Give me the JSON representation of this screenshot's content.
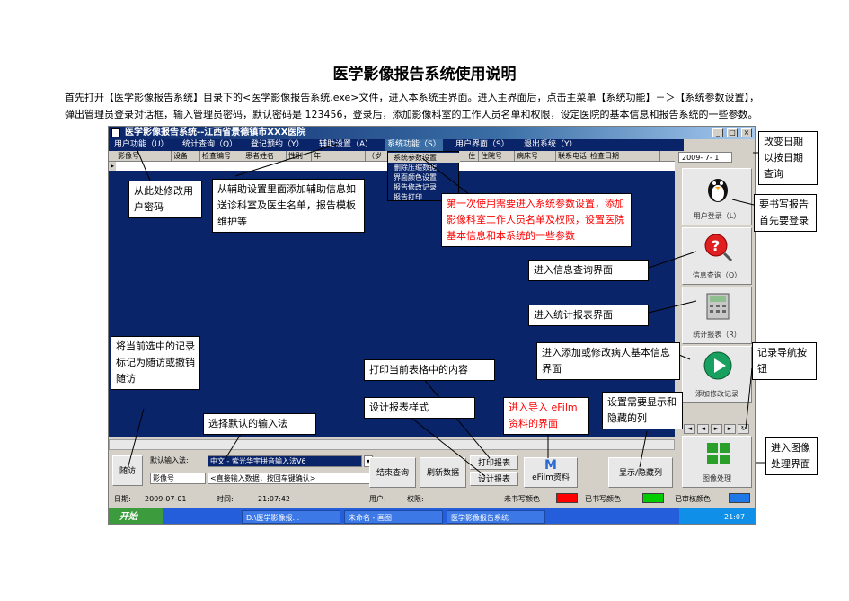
{
  "doc": {
    "title": "医学影像报告系统使用说明",
    "para1": "首先打开【医学影像报告系统】目录下的<医学影像报告系统.exe>文件，进入本系统主界面。进入主界面后，点击主菜单【系统功能】－＞【系统参数设置】，",
    "para2": "弹出管理员登录对话框，输入管理员密码，默认密码是 123456，登录后，添加影像科室的工作人员名单和权限，设定医院的基本信息和报告系统的一些参数。"
  },
  "app": {
    "window_title": "医学影像报告系统--江西省景德镇市XXX医院",
    "menu": [
      "用户功能（U）",
      "统计查询（Q）",
      "登记预约（Y）",
      "辅助设置（A）",
      "系统功能（S）",
      "用户界面（S）",
      "退出系统（Y）"
    ],
    "dropdown": [
      "系统参数设置",
      "删除压缩数据",
      "界面颜色设置",
      "报告修改记录",
      "报告打印"
    ],
    "columns": [
      "影像号",
      "设备",
      "检查编号",
      "患者姓名",
      "性别",
      "年",
      "（岁",
      "住",
      "住院号",
      "病床号",
      "联系电话",
      "检查日期"
    ],
    "date": "2009- 7- 1",
    "big_buttons": {
      "login": "用户登录（L）",
      "query": "信息查询（Q）",
      "report": "统计报表（R）",
      "add": "添加修改记录",
      "image": "图像处理"
    },
    "nav": [
      "◄",
      "◄",
      "►",
      "►"
    ],
    "followup": "随访",
    "input_label": "默认输入法:",
    "input_value": "中文 - 紫光华宇拼音输入法V6",
    "search_type": "影像号",
    "search_hint": "<直接输入数据，按回车键确认>",
    "btn_end_query": "结束查询",
    "btn_refresh": "刷新数据",
    "btn_print": "打印报表",
    "btn_design": "设计报表",
    "btn_efilm": "eFilm资料",
    "btn_show_hide": "显示/隐藏列",
    "status": {
      "date_label": "日期:",
      "date_value": "2009-07-01",
      "time_label": "时间:",
      "time_value": "21:07:42",
      "user_label": "用户:",
      "perm_label": "权限:",
      "unwritten": "未书写颜色",
      "written": "已书写颜色",
      "audited": "已审核颜色"
    },
    "colors": {
      "unwritten": "#ff0000",
      "written": "#00cc00",
      "audited": "#1e78e8"
    },
    "taskbar": {
      "start": "开始",
      "tasks": [
        "D:\\医学影像报...",
        "未命名 - 画图",
        "医学影像报告系统"
      ],
      "tray_time": "21:07"
    }
  },
  "callouts": {
    "date": "改变日期以按日期查询",
    "password": "从此处修改用户密码",
    "assist": "从辅助设置里面添加辅助信息如送诊科室及医生名单，报告模板维护等",
    "first_use": "第一次使用需要进入系统参数设置，添加影像科室工作人员名单及权限，设置医院基本信息和本系统的一些参数",
    "login": "要书写报告首先要登录",
    "query": "进入信息查询界面",
    "report": "进入统计报表界面",
    "add": "进入添加或修改病人基本信息界面",
    "nav": "记录导航按钮",
    "followup": "将当前选中的记录标记为随访或撤销随访",
    "print": "打印当前表格中的内容",
    "design": "设计报表样式",
    "input": "选择默认的输入法",
    "efilm": "进入导入 eFilm资料的界面",
    "show_hide": "设置需要显示和隐藏的列",
    "image": "进入图像处理界面"
  }
}
